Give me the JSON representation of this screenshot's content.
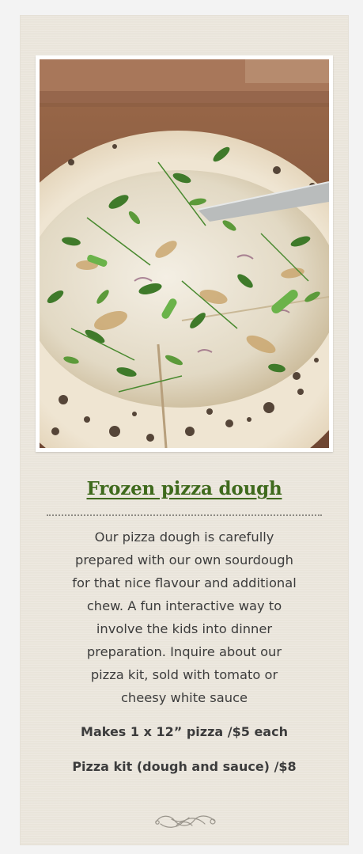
{
  "product": {
    "photo_alt": "white pizza topped with fresh herbs",
    "title": "Frozen pizza dough",
    "description_lines": [
      "Our pizza dough is carefully",
      "prepared with our own sourdough",
      "for that nice flavour and additional",
      "chew. A fun interactive way to",
      "involve the kids into dinner",
      "preparation. Inquire about our",
      "pizza kit, sold with tomato or",
      "cheesy white sauce"
    ],
    "details": [
      "Makes 1 x 12” pizza /$5 each",
      "Pizza kit (dough and sauce) /$8"
    ]
  },
  "colors": {
    "title": "#3f6a1d",
    "card_background": "#ebe6dc",
    "body_text": "#3c3c3c"
  },
  "icons": {
    "ornament": "flourish-ornament-icon"
  }
}
